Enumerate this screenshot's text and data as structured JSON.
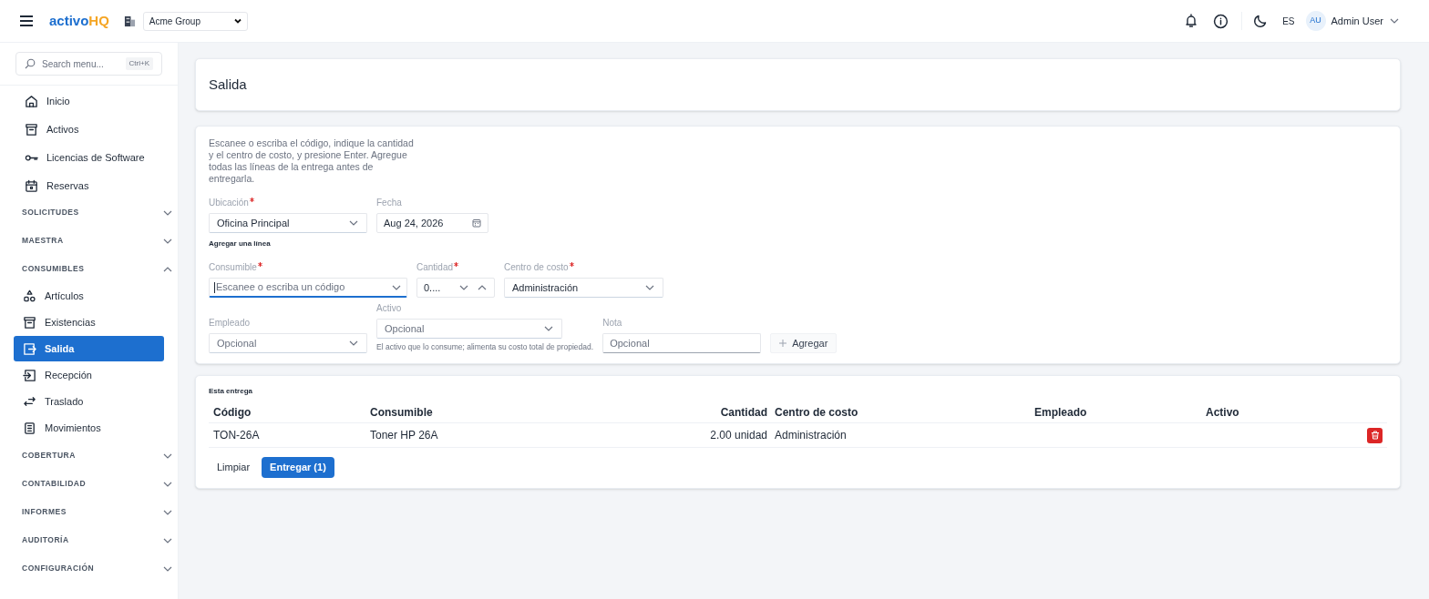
{
  "header": {
    "brand": "activo",
    "brand_accent": "HQ",
    "company": "Acme Group",
    "language": "ES",
    "user_initials": "AU",
    "user_name": "Admin User"
  },
  "sidebar": {
    "search": {
      "placeholder": "Search menu...",
      "shortcut": "Ctrl+K"
    },
    "items": [
      {
        "kind": "link",
        "label": "Inicio",
        "selected": false
      },
      {
        "kind": "link",
        "label": "Activos",
        "selected": false
      },
      {
        "kind": "link",
        "label": "Licencias de Software",
        "selected": false
      },
      {
        "kind": "link",
        "label": "Reservas",
        "selected": false
      },
      {
        "kind": "section",
        "label": "SOLICITUDES",
        "expanded": false
      },
      {
        "kind": "section",
        "label": "MAESTRA",
        "expanded": false
      },
      {
        "kind": "section",
        "label": "CONSUMIBLES",
        "expanded": true,
        "children": [
          {
            "label": "Artículos",
            "selected": false
          },
          {
            "label": "Existencias",
            "selected": false
          },
          {
            "label": "Salida",
            "selected": true
          },
          {
            "label": "Recepción",
            "selected": false
          },
          {
            "label": "Traslado",
            "selected": false
          },
          {
            "label": "Movimientos",
            "selected": false
          }
        ]
      },
      {
        "kind": "section",
        "label": "COBERTURA",
        "expanded": false
      },
      {
        "kind": "section",
        "label": "CONTABILIDAD",
        "expanded": false
      },
      {
        "kind": "section",
        "label": "INFORMES",
        "expanded": false
      },
      {
        "kind": "section",
        "label": "AUDITORÍA",
        "expanded": false
      },
      {
        "kind": "section",
        "label": "CONFIGURACIÓN",
        "expanded": false
      }
    ]
  },
  "page": {
    "title": "Salida",
    "instructions": "Escanee o escriba el código, indique la cantidad y el centro de costo, y presione Enter. Agregue todas las líneas de la entrega antes de entregarla.",
    "ubicacion": {
      "label": "Ubicación",
      "required": true,
      "value": "Oficina Principal"
    },
    "fecha": {
      "label": "Fecha",
      "value": "Aug 24, 2026"
    },
    "add_line_title": "Agregar una línea",
    "consumible": {
      "label": "Consumible",
      "required": true,
      "placeholder": "Escanee o escriba un código"
    },
    "cantidad": {
      "label": "Cantidad",
      "required": true,
      "value": "0...."
    },
    "centro": {
      "label": "Centro de costo",
      "required": true,
      "value": "Administración"
    },
    "empleado": {
      "label": "Empleado",
      "placeholder": "Opcional"
    },
    "activo": {
      "label": "Activo",
      "placeholder": "Opcional",
      "help": "El activo que lo consume; alimenta su costo total de propiedad."
    },
    "nota": {
      "label": "Nota",
      "placeholder": "Opcional"
    },
    "add_button": "Agregar",
    "delivery": {
      "title": "Esta entrega",
      "columns": [
        "Código",
        "Consumible",
        "Cantidad",
        "Centro de costo",
        "Empleado",
        "Activo"
      ],
      "rows": [
        {
          "codigo": "TON-26A",
          "consumible": "Toner HP 26A",
          "cantidad": "2.00 unidad",
          "centro": "Administración"
        }
      ],
      "clear_button": "Limpiar",
      "deliver_button": "Entregar (1)"
    }
  }
}
